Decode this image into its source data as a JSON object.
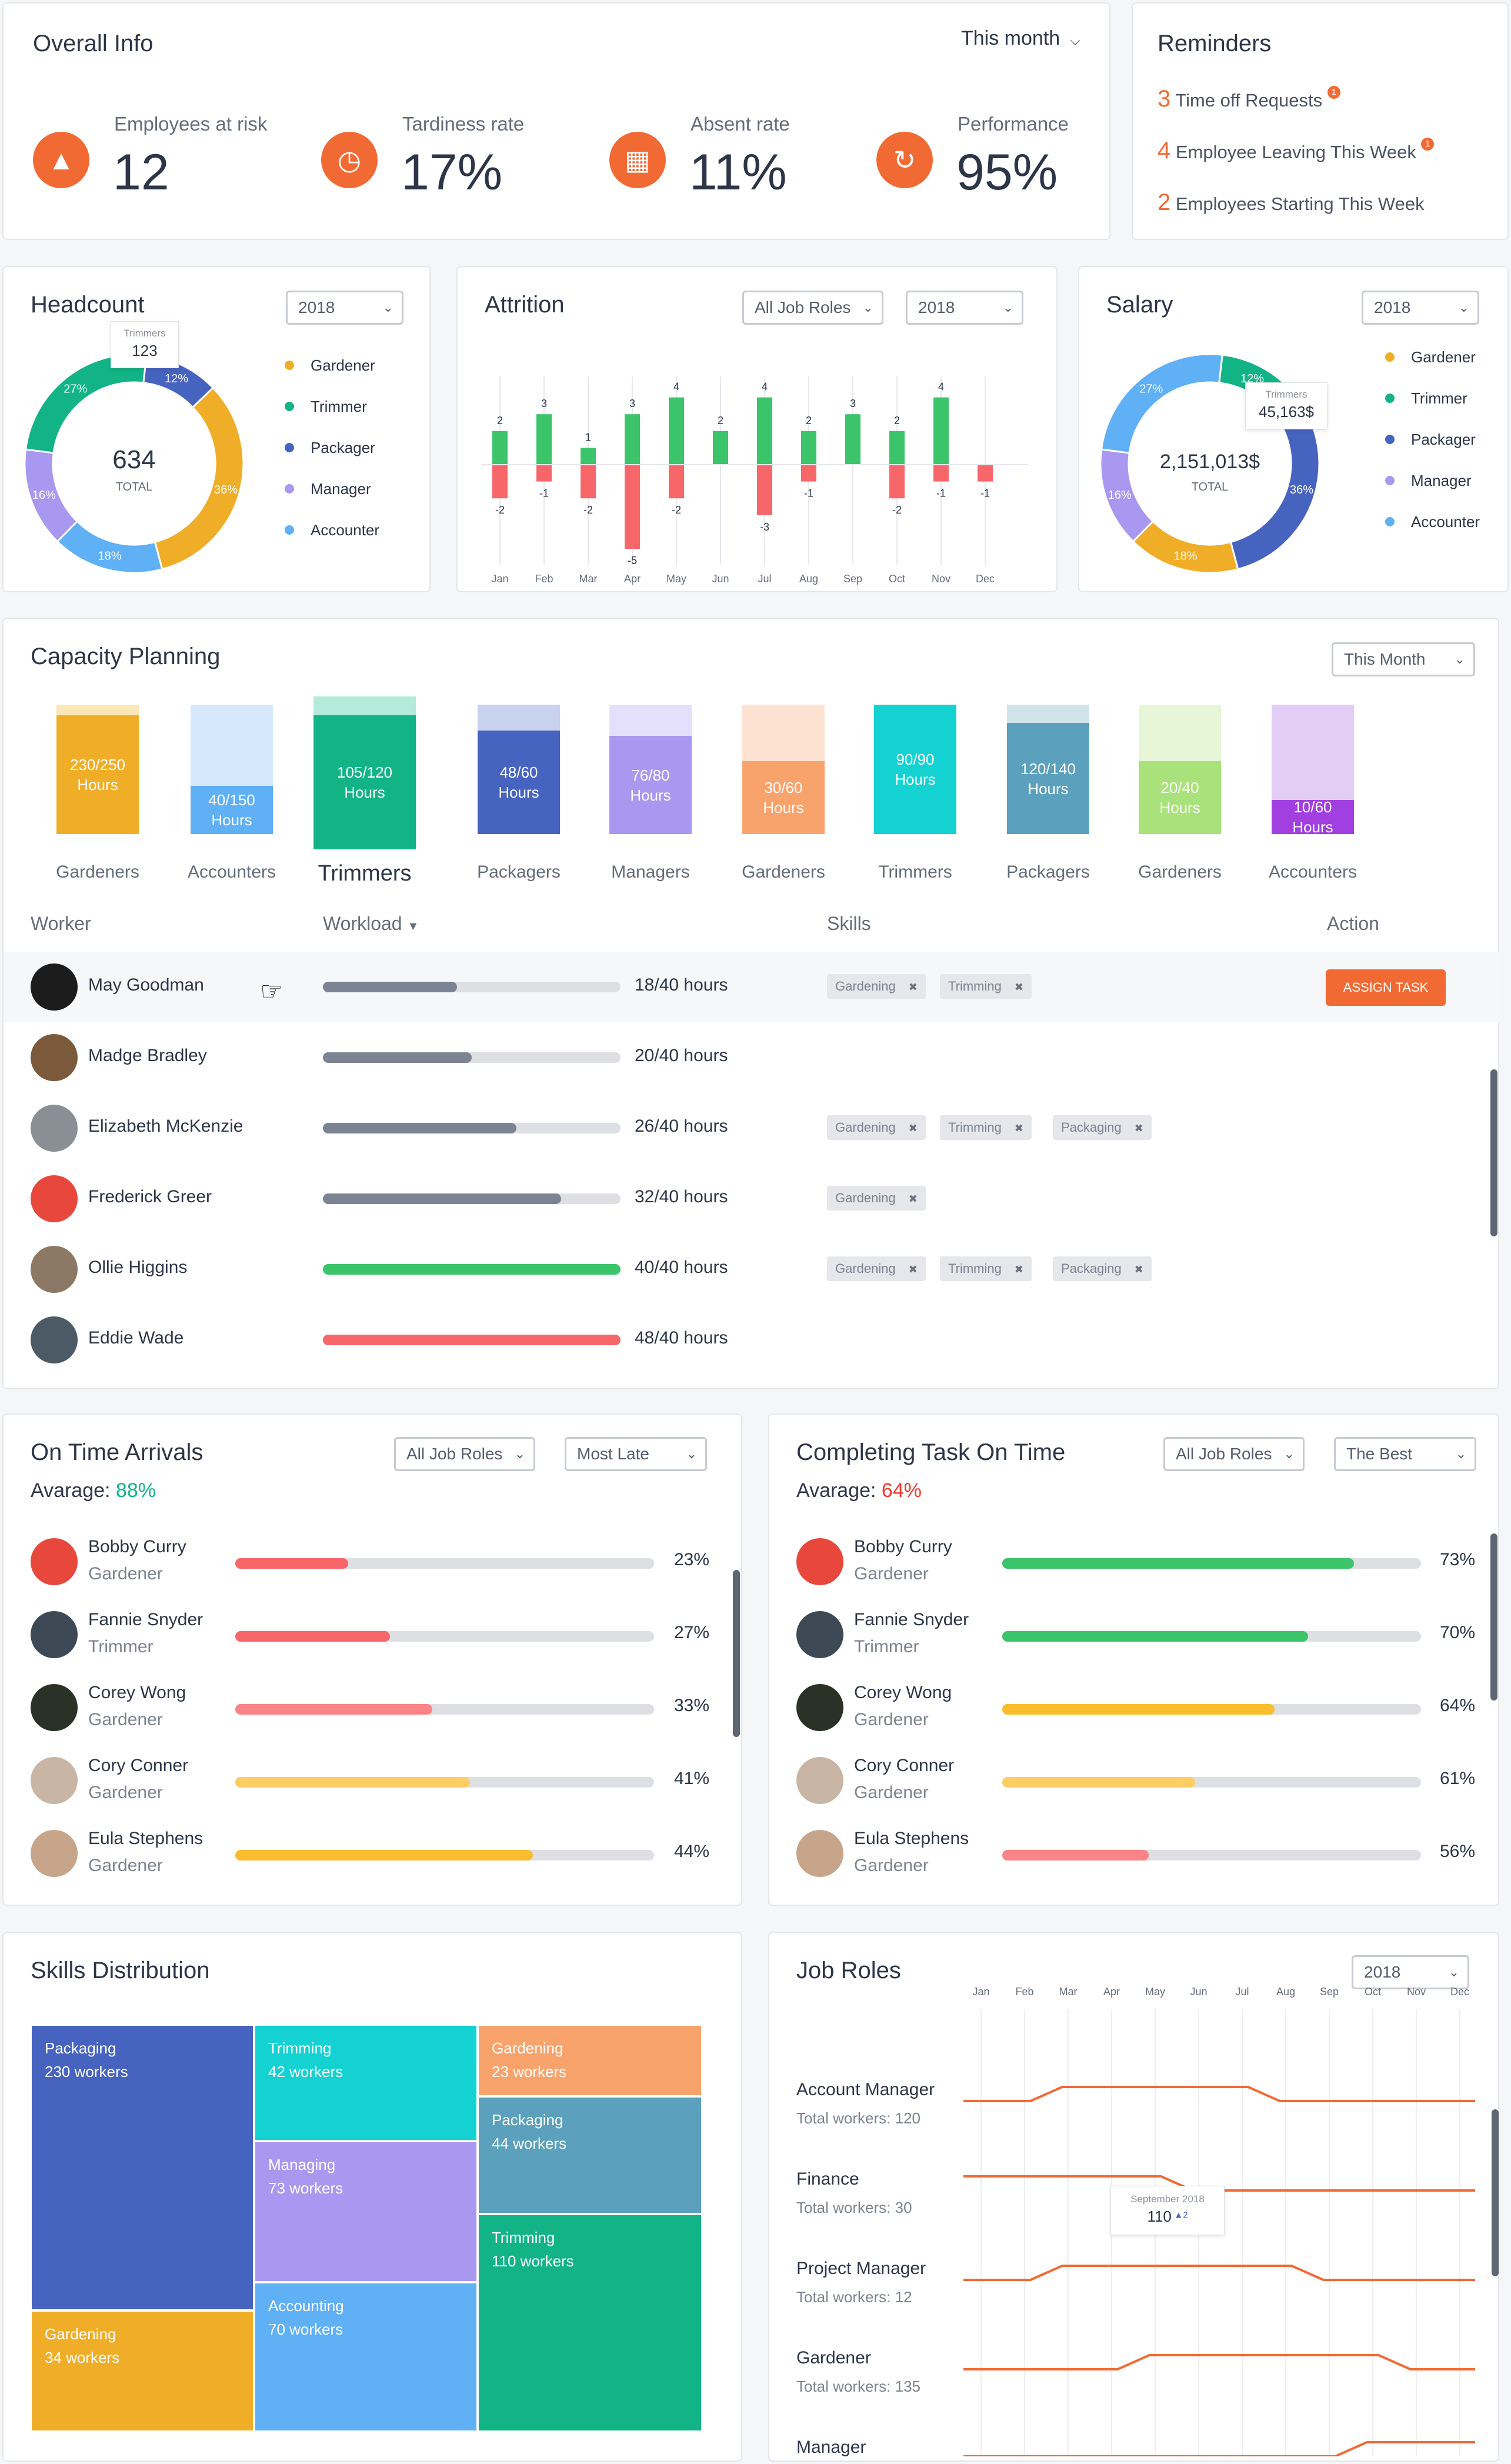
{
  "overall": {
    "title": "Overall Info",
    "period": "This month",
    "kpis": [
      {
        "label": "Employees at risk",
        "value": "12",
        "icon": "warning-icon"
      },
      {
        "label": "Tardiness rate",
        "value": "17%",
        "icon": "clock-icon"
      },
      {
        "label": "Absent rate",
        "value": "11%",
        "icon": "calendar-icon"
      },
      {
        "label": "Performance",
        "value": "95%",
        "icon": "refresh-icon"
      }
    ]
  },
  "reminders": {
    "title": "Reminders",
    "items": [
      {
        "count": "3",
        "text": "Time off Requests",
        "badge": "1"
      },
      {
        "count": "4",
        "text": "Employee Leaving This Week",
        "badge": "1"
      },
      {
        "count": "2",
        "text": "Employees Starting This Week",
        "badge": ""
      }
    ]
  },
  "headcount": {
    "title": "Headcount",
    "year": "2018",
    "total": "634",
    "total_label": "TOTAL",
    "tooltip": {
      "name": "Trimmers",
      "value": "123"
    },
    "legend": [
      "Gardener",
      "Trimmer",
      "Packager",
      "Manager",
      "Accounter"
    ]
  },
  "attrition": {
    "title": "Attrition",
    "roles": "All Job Roles",
    "year": "2018"
  },
  "salary": {
    "title": "Salary",
    "year": "2018",
    "total": "2,151,013$",
    "total_label": "TOTAL",
    "tooltip": {
      "name": "Trimmers",
      "value": "45,163$"
    },
    "legend": [
      "Gardener",
      "Trimmer",
      "Packager",
      "Manager",
      "Accounter"
    ]
  },
  "colors": {
    "gardener": "#f0ae28",
    "trimmer": "#12b487",
    "packager": "#4763c0",
    "manager": "#a898f0",
    "accounter": "#5fb0f5",
    "accent": "#f26a33",
    "green": "#3cc46a",
    "red": "#f7676a",
    "yellow": "#f9bd2e",
    "gray": "#7c8494"
  },
  "chart_data": [
    {
      "type": "pie",
      "title": "Headcount",
      "labels": [
        "Trimmer",
        "Packager",
        "Gardener",
        "Accounter",
        "Manager"
      ],
      "values": [
        27,
        12,
        36,
        18,
        16
      ],
      "total": 634
    },
    {
      "type": "bar",
      "title": "Attrition",
      "categories": [
        "Jan",
        "Feb",
        "Mar",
        "Apr",
        "May",
        "Jun",
        "Jul",
        "Aug",
        "Sep",
        "Oct",
        "Nov",
        "Dec"
      ],
      "series": [
        {
          "values": [
            2,
            3,
            1,
            3,
            4,
            2,
            4,
            2,
            3,
            2,
            4,
            0
          ]
        },
        {
          "values": [
            -2,
            -1,
            -2,
            -5,
            -2,
            0,
            -3,
            -1,
            0,
            -2,
            -1,
            -1
          ]
        }
      ]
    },
    {
      "type": "pie",
      "title": "Salary",
      "labels": [
        "Accounter",
        "Trimmer",
        "Packager",
        "Gardener",
        "Manager"
      ],
      "values": [
        27,
        12,
        36,
        18,
        16
      ],
      "total": "2,151,013$"
    }
  ],
  "capacity": {
    "title": "Capacity Planning",
    "period": "This Month",
    "cols": [
      {
        "label": "Gardeners",
        "text": "230/250\nHours",
        "used": 230,
        "cap": 250,
        "color": "#f0ae28",
        "light": "#fbe6b6"
      },
      {
        "label": "Accounters",
        "text": "40/150\nHours",
        "used": 40,
        "cap": 150,
        "color": "#5fb0f5",
        "light": "#d6e9fc"
      },
      {
        "label": "Trimmers",
        "text": "105/120\nHours",
        "used": 105,
        "cap": 120,
        "color": "#12b487",
        "light": "#b3ead9"
      },
      {
        "label": "Packagers",
        "text": "48/60\nHours",
        "used": 48,
        "cap": 60,
        "color": "#4763c0",
        "light": "#c8d1ee"
      },
      {
        "label": "Managers",
        "text": "76/80\nHours",
        "used": 76,
        "cap": 80,
        "color": "#a898f0",
        "light": "#e4e0fb"
      },
      {
        "label": "Gardeners",
        "text": "30/60\nHours",
        "used": 30,
        "cap": 60,
        "color": "#f9a36c",
        "light": "#fde2d1"
      },
      {
        "label": "Trimmers",
        "text": "90/90\nHours",
        "used": 90,
        "cap": 90,
        "color": "#14d2d2",
        "light": "#b9f1f1"
      },
      {
        "label": "Packagers",
        "text": "120/140\nHours",
        "used": 120,
        "cap": 140,
        "color": "#5ba1bd",
        "light": "#cfe3ea"
      },
      {
        "label": "Gardeners",
        "text": "20/40\nHours",
        "used": 20,
        "cap": 40,
        "color": "#a9e27a",
        "light": "#e6f6d6"
      },
      {
        "label": "Accounters",
        "text": "10/60\nHours",
        "used": 10,
        "cap": 60,
        "color": "#a23fe0",
        "light": "#e3cdf6"
      }
    ],
    "headers": {
      "worker": "Worker",
      "workload": "Workload",
      "skills": "Skills",
      "action": "Action"
    },
    "assign": "ASSIGN TASK",
    "workers": [
      {
        "name": "May Goodman",
        "hours": "18/40 hours",
        "load": 0.45,
        "color": "#7c8494",
        "skills": [
          "Gardening",
          "Trimming"
        ],
        "avatar": "#1c1c1c"
      },
      {
        "name": "Madge Bradley",
        "hours": "20/40 hours",
        "load": 0.5,
        "color": "#7c8494",
        "skills": [],
        "avatar": "#7a5a3a"
      },
      {
        "name": "Elizabeth McKenzie",
        "hours": "26/40 hours",
        "load": 0.65,
        "color": "#7c8494",
        "skills": [
          "Gardening",
          "Trimming",
          "Packaging"
        ],
        "avatar": "#8a8f96"
      },
      {
        "name": "Frederick Greer",
        "hours": "32/40 hours",
        "load": 0.8,
        "color": "#7c8494",
        "skills": [
          "Gardening"
        ],
        "avatar": "#e8483c"
      },
      {
        "name": "Ollie Higgins",
        "hours": "40/40 hours",
        "load": 1,
        "color": "#3cc46a",
        "skills": [
          "Gardening",
          "Trimming",
          "Packaging"
        ],
        "avatar": "#8d7765"
      },
      {
        "name": "Eddie Wade",
        "hours": "48/40 hours",
        "load": 1,
        "color": "#f7676a",
        "skills": [],
        "avatar": "#4c5a66"
      }
    ]
  },
  "arrivals": {
    "title": "On Time Arrivals",
    "roles": "All Job Roles",
    "sort": "Most Late",
    "avg_label": "Avarage:",
    "avg": "88%",
    "people": [
      {
        "name": "Bobby Curry",
        "role": "Gardener",
        "pct": "23%",
        "v": 0.27,
        "color": "#f7676a",
        "avatar": "#e8483c"
      },
      {
        "name": "Fannie Snyder",
        "role": "Trimmer",
        "pct": "27%",
        "v": 0.37,
        "color": "#f7676a",
        "avatar": "#3d4a55"
      },
      {
        "name": "Corey Wong",
        "role": "Gardener",
        "pct": "33%",
        "v": 0.47,
        "color": "#f98386",
        "avatar": "#2a3228"
      },
      {
        "name": "Cory Conner",
        "role": "Gardener",
        "pct": "41%",
        "v": 0.56,
        "color": "#fbcd63",
        "avatar": "#c9b5a3"
      },
      {
        "name": "Eula Stephens",
        "role": "Gardener",
        "pct": "44%",
        "v": 0.71,
        "color": "#f9bd2e",
        "avatar": "#c7a58a"
      }
    ]
  },
  "completing": {
    "title": "Completing Task On Time",
    "roles": "All Job Roles",
    "sort": "The Best",
    "avg_label": "Avarage:",
    "avg": "64%",
    "people": [
      {
        "name": "Bobby Curry",
        "role": "Gardener",
        "pct": "73%",
        "v": 0.84,
        "color": "#3cc46a",
        "avatar": "#e8483c"
      },
      {
        "name": "Fannie Snyder",
        "role": "Trimmer",
        "pct": "70%",
        "v": 0.73,
        "color": "#3cc46a",
        "avatar": "#3d4a55"
      },
      {
        "name": "Corey Wong",
        "role": "Gardener",
        "pct": "64%",
        "v": 0.65,
        "color": "#f9bd2e",
        "avatar": "#2a3228"
      },
      {
        "name": "Cory Conner",
        "role": "Gardener",
        "pct": "61%",
        "v": 0.46,
        "color": "#fbcd63",
        "avatar": "#c9b5a3"
      },
      {
        "name": "Eula Stephens",
        "role": "Gardener",
        "pct": "56%",
        "v": 0.35,
        "color": "#f98386",
        "avatar": "#c7a58a"
      }
    ]
  },
  "skills": {
    "title": "Skills Distribution",
    "tiles": [
      {
        "name": "Packaging",
        "workers": "230 workers",
        "color": "#4763c0"
      },
      {
        "name": "Gardening",
        "workers": "34 workers",
        "color": "#f0ae28"
      },
      {
        "name": "Trimming",
        "workers": "42 workers",
        "color": "#14d2d2"
      },
      {
        "name": "Managing",
        "workers": "73 workers",
        "color": "#a898f0"
      },
      {
        "name": "Accounting",
        "workers": "70 workers",
        "color": "#5fb0f5"
      },
      {
        "name": "Gardening",
        "workers": "23 workers",
        "color": "#f9a36c"
      },
      {
        "name": "Packaging",
        "workers": "44 workers",
        "color": "#5ba1bd"
      },
      {
        "name": "Trimming",
        "workers": "110 workers",
        "color": "#12b487"
      }
    ]
  },
  "jobroles": {
    "title": "Job Roles",
    "year": "2018",
    "months": [
      "Jan",
      "Feb",
      "Mar",
      "Apr",
      "May",
      "Jun",
      "Jul",
      "Aug",
      "Sep",
      "Oct",
      "Nov",
      "Dec"
    ],
    "tooltip": {
      "date": "September 2018",
      "value": "110",
      "delta": "▲2"
    },
    "roles": [
      {
        "name": "Account Manager",
        "sub": "Total workers: 120"
      },
      {
        "name": "Finance",
        "sub": "Total workers: 30"
      },
      {
        "name": "Project Manager",
        "sub": "Total workers: 12"
      },
      {
        "name": "Gardener",
        "sub": "Total workers: 135"
      },
      {
        "name": "Manager",
        "sub": ""
      }
    ]
  }
}
